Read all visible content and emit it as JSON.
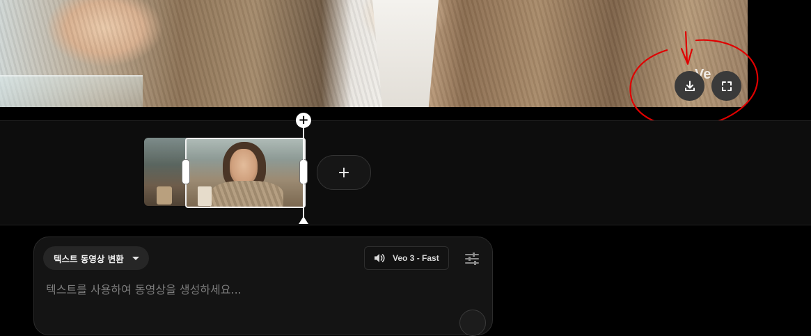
{
  "preview": {
    "overlay_text": "Ve",
    "buttons": [
      {
        "name": "download-button",
        "icon": "download-icon"
      },
      {
        "name": "fullscreen-button",
        "icon": "fullscreen-icon"
      }
    ],
    "annotation_color": "#e00000"
  },
  "timeline": {
    "add_clip_icon": "plus-icon",
    "playhead_icon": "plus-icon"
  },
  "prompt": {
    "mode_label": "텍스트 동영상 변환",
    "model_label": "Veo 3 - Fast",
    "model_icon": "speaker-icon",
    "settings_icon": "sliders-icon",
    "placeholder": "텍스트를 사용하여 동영상을 생성하세요..."
  },
  "colors": {
    "background": "#000000",
    "panel": "#141414",
    "accent_white": "#ffffff"
  }
}
